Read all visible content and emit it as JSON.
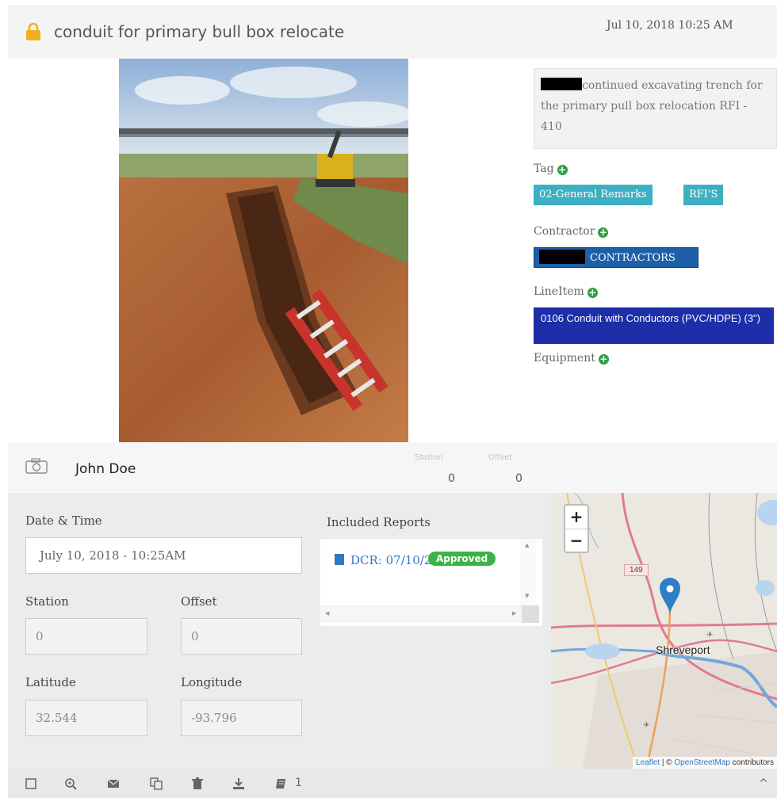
{
  "header": {
    "title": "conduit for primary bull box relocate",
    "timestamp": "Jul 10, 2018 10:25 AM"
  },
  "description": {
    "text": "continued excavating trench for the primary pull box relocation RFI - 410"
  },
  "sections": {
    "tag_label": "Tag",
    "tags": [
      "02-General Remarks",
      "RFI'S"
    ],
    "contractor_label": "Contractor",
    "contractor_value": "CONTRACTORS",
    "lineitem_label": "LineItem",
    "lineitem_value": "0106 Conduit with Conductors (PVC/HDPE) (3\")",
    "equipment_label": "Equipment"
  },
  "infobar": {
    "user": "John Doe",
    "station_label": "Station",
    "station_value": "0",
    "offset_label": "Offset",
    "offset_value": "0"
  },
  "form": {
    "datetime_label": "Date & Time",
    "datetime_value": "July 10, 2018 - 10:25AM",
    "station_label": "Station",
    "station_value": "0",
    "offset_label": "Offset",
    "offset_value": "0",
    "latitude_label": "Latitude",
    "latitude_value": "32.544",
    "longitude_label": "Longitude",
    "longitude_value": "-93.796",
    "reports_label": "Included Reports",
    "report_link": "DCR: 07/10/2018",
    "report_status": "Approved"
  },
  "map": {
    "zoom_in": "+",
    "zoom_out": "−",
    "city": "Shreveport",
    "highway": "149",
    "attrib_leaflet": "Leaflet",
    "attrib_osm": "OpenStreetMap",
    "attrib_rest": "contributors"
  },
  "toolbar": {
    "report_count": "1"
  },
  "colors": {
    "tag": "#3cb0c2",
    "contractor": "#1d5fa8",
    "lineitem": "#1d2ea8",
    "approved": "#3cb24a",
    "link": "#2e78c7"
  }
}
